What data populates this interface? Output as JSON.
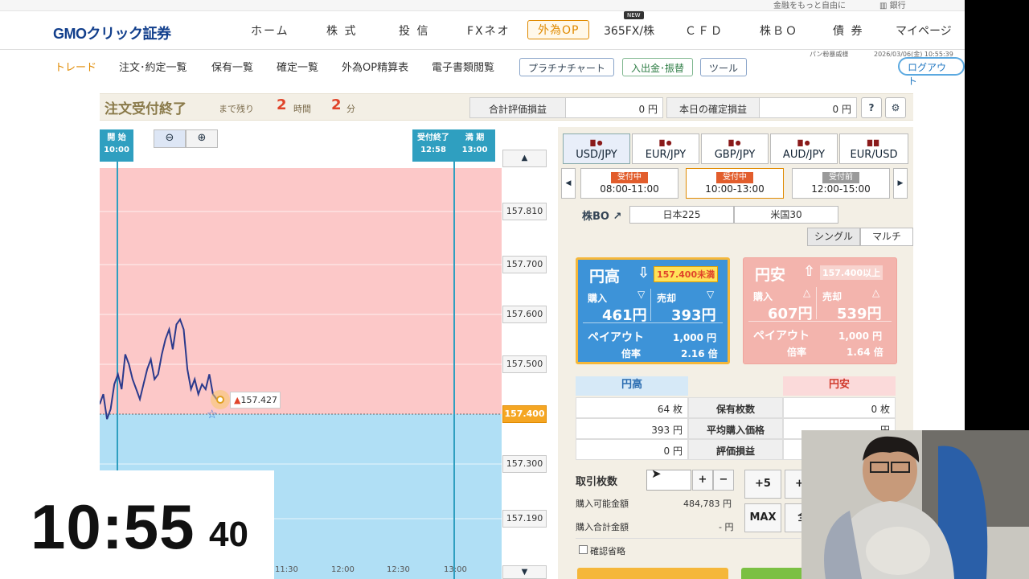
{
  "topstrip": {
    "left_text": "金融をもっと自由に",
    "right_text": "銀行"
  },
  "nav": {
    "logo": "GMOクリック証券",
    "items": [
      "ホーム",
      "株 式",
      "投 信",
      "FXネオ",
      "外為OP",
      "365FX/株",
      "ＣＦＤ",
      "株ＢＯ",
      "債 券",
      "マイページ"
    ],
    "selected": "外為OP",
    "new_badge": "NEW"
  },
  "subnav": {
    "items": [
      "トレード",
      "注文･約定一覧",
      "保有一覧",
      "確定一覧",
      "外為OP精算表",
      "電子書類閲覧"
    ],
    "active": "トレード",
    "pills": [
      "プラチナチャート",
      "入出金･振替",
      "ツール"
    ],
    "user": "パン粉暴威様",
    "datetime": "2026/03/06(金) 10:55:39",
    "logout": "ログアウト"
  },
  "status": {
    "title": "注文受付終了",
    "remaining_label": "まで残り",
    "hours": "2",
    "hours_unit": "時間",
    "minutes": "2",
    "minutes_unit": "分",
    "total_pl_label": "合計評価損益",
    "total_pl": "0 円",
    "today_pl_label": "本日の確定損益",
    "today_pl": "0 円",
    "help_icon": "?",
    "settings_icon": "gear-icon"
  },
  "chart": {
    "start_label": "開 始",
    "start_time": "10:00",
    "cutoff_label": "受付終了",
    "cutoff_time": "12:58",
    "expiry_label": "満 期",
    "expiry_time": "13:00",
    "current_price": "157.400",
    "last_price_label": "157.427",
    "y_ticks": [
      "157.810",
      "157.700",
      "157.600",
      "157.500",
      "157.300",
      "157.190"
    ],
    "x_ticks": [
      "11:30",
      "12:00",
      "12:30",
      "13:00"
    ],
    "colors": {
      "above": "#fcc8c8",
      "below": "#b0dff5",
      "line": "#2b3a8c",
      "guide": "#2f9fc0"
    },
    "series": [
      157.42,
      157.44,
      157.39,
      157.41,
      157.46,
      157.48,
      157.45,
      157.52,
      157.5,
      157.47,
      157.45,
      157.43,
      157.46,
      157.49,
      157.51,
      157.47,
      157.48,
      157.52,
      157.55,
      157.57,
      157.53,
      157.58,
      157.59,
      157.57,
      157.49,
      157.45,
      157.47,
      157.44,
      157.46,
      157.45,
      157.48,
      157.44,
      157.43,
      157.427
    ]
  },
  "panel": {
    "pairs": [
      {
        "label": "USD/JPY"
      },
      {
        "label": "EUR/JPY"
      },
      {
        "label": "GBP/JPY"
      },
      {
        "label": "AUD/JPY"
      },
      {
        "label": "EUR/USD"
      }
    ],
    "slots": [
      {
        "badge": "受付中",
        "time": "08:00-11:00"
      },
      {
        "badge": "受付中",
        "time": "10:00-13:00"
      },
      {
        "badge": "受付前",
        "time": "12:00-15:00"
      }
    ],
    "kabu_bo": "株BO",
    "tabs": [
      "日本225",
      "米国30"
    ],
    "modes": [
      "シングル",
      "マルチ"
    ],
    "up_card": {
      "title": "円高",
      "strike": "157.400未満",
      "buy_label": "購入",
      "sell_label": "売却",
      "buy": "461円",
      "sell": "393円",
      "payout_label": "ペイアウト",
      "payout": "1,000 円",
      "ratio_label": "倍率",
      "ratio": "2.16 倍"
    },
    "down_card": {
      "title": "円安",
      "strike": "157.400以上",
      "buy_label": "購入",
      "sell_label": "売却",
      "buy": "607円",
      "sell": "539円",
      "payout_label": "ペイアウト",
      "payout": "1,000 円",
      "ratio_label": "倍率",
      "ratio": "1.64 倍"
    },
    "table": {
      "up_header": "円高",
      "down_header": "円安",
      "rows": [
        {
          "up": "64 枚",
          "label": "保有枚数",
          "down": "0 枚"
        },
        {
          "up": "393 円",
          "label": "平均購入価格",
          "down": "- 円"
        },
        {
          "up": "0 円",
          "label": "評価損益",
          "down": ""
        }
      ]
    },
    "qty_label": "取引枚数",
    "plus": "+",
    "minus": "−",
    "plus5": "+5",
    "plus10": "+1",
    "max": "MAX",
    "all": "全",
    "available_label": "購入可能金額",
    "available": "484,783 円",
    "total_label": "購入合計金額",
    "total": "- 円",
    "confirm_skip": "確認省略"
  }
}
